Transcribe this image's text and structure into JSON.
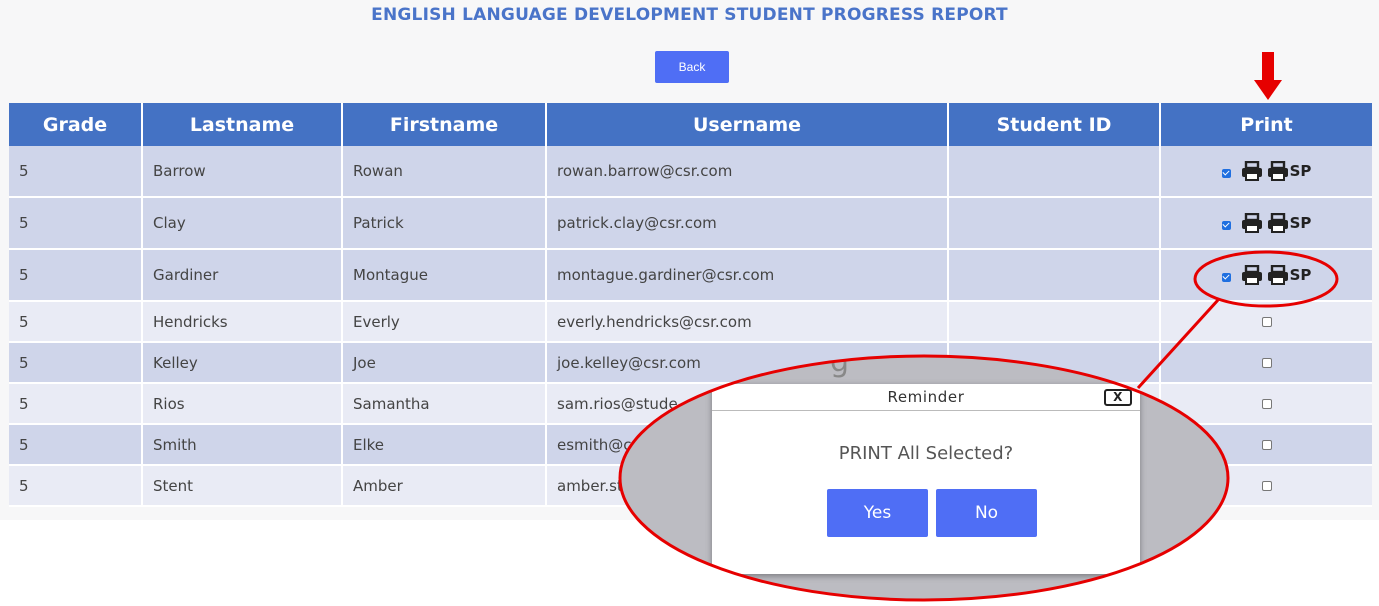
{
  "report": {
    "title": "ENGLISH LANGUAGE DEVELOPMENT STUDENT PROGRESS REPORT"
  },
  "toolbar": {
    "back_label": "Back"
  },
  "table": {
    "headers": [
      "Grade",
      "Lastname",
      "Firstname",
      "Username",
      "Student ID",
      "Print"
    ],
    "rows": [
      {
        "grade": "5",
        "lastname": "Barrow",
        "firstname": "Rowan",
        "username": "rowan.barrow@csr.com",
        "student_id": "",
        "selected": true
      },
      {
        "grade": "5",
        "lastname": "Clay",
        "firstname": "Patrick",
        "username": "patrick.clay@csr.com",
        "student_id": "",
        "selected": true
      },
      {
        "grade": "5",
        "lastname": "Gardiner",
        "firstname": "Montague",
        "username": "montague.gardiner@csr.com",
        "student_id": "",
        "selected": true
      },
      {
        "grade": "5",
        "lastname": "Hendricks",
        "firstname": "Everly",
        "username": "everly.hendricks@csr.com",
        "student_id": "",
        "selected": false
      },
      {
        "grade": "5",
        "lastname": "Kelley",
        "firstname": "Joe",
        "username": "joe.kelley@csr.com",
        "student_id": "",
        "selected": false
      },
      {
        "grade": "5",
        "lastname": "Rios",
        "firstname": "Samantha",
        "username": "sam.rios@stude",
        "student_id": "",
        "selected": false
      },
      {
        "grade": "5",
        "lastname": "Smith",
        "firstname": "Elke",
        "username": "esmith@c",
        "student_id": "",
        "selected": false
      },
      {
        "grade": "5",
        "lastname": "Stent",
        "firstname": "Amber",
        "username": "amber.st",
        "student_id": "",
        "selected": false
      }
    ],
    "sp_label": "SP"
  },
  "modal": {
    "title": "Reminder",
    "close_label": "X",
    "message": "PRINT All Selected?",
    "yes_label": "Yes",
    "no_label": "No"
  },
  "colors": {
    "accent": "#4f6ef5",
    "header_bg": "#4472c4",
    "title": "#4a74c9",
    "annotation": "#e60000"
  },
  "icons": [
    "printer-icon",
    "printer-sp-icon",
    "arrow-down-icon",
    "close-icon"
  ]
}
